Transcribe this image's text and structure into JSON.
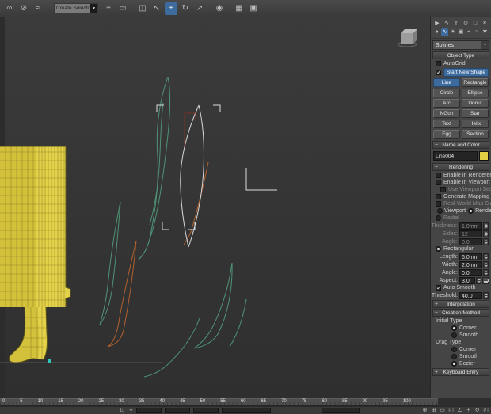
{
  "colors": {
    "accent_blue": "#3e6b9e",
    "object_yellow": "#d4c13b",
    "object_yellow_light": "#e3d249",
    "object_wire": "#81731f",
    "object_outline": "#5f5616",
    "spline_green": "#4f9377",
    "spline_white": "#d8d8d8",
    "spline_orange": "#b2602c",
    "spline_red": "#8a3020",
    "bracket_white": "#dddddd",
    "vertex_teal": "#2ec4b6",
    "ground_line": "#565656",
    "name_swatch": "#e0cf45"
  },
  "glyphs": {
    "dropdown_arrow": "▼"
  },
  "toolbar": {
    "selection_set_value": "Create Selection Se",
    "icons": [
      {
        "name": "select-and-link",
        "glyph": "∞"
      },
      {
        "name": "unlink-selection",
        "glyph": "⊘"
      },
      {
        "name": "bind-to-space-warp",
        "glyph": "≈"
      },
      {
        "name": "select-by-name",
        "glyph": "≡"
      },
      {
        "name": "rectangular-selection-region",
        "glyph": "▭"
      },
      {
        "name": "window-crossing",
        "glyph": "◫"
      },
      {
        "name": "select-object",
        "glyph": "↖"
      },
      {
        "name": "select-and-move",
        "glyph": "+"
      },
      {
        "name": "select-and-rotate",
        "glyph": "↻"
      },
      {
        "name": "select-and-scale",
        "glyph": "↗"
      },
      {
        "name": "material-editor",
        "glyph": "◉"
      },
      {
        "name": "render-setup",
        "glyph": "▦"
      },
      {
        "name": "rendered-frame-window",
        "glyph": "▣"
      }
    ]
  },
  "command_panel": {
    "tabs": [
      {
        "name": "create",
        "glyph": "▶"
      },
      {
        "name": "modify",
        "glyph": "∿"
      },
      {
        "name": "hierarchy",
        "glyph": "Y"
      },
      {
        "name": "motion",
        "glyph": "⊙"
      },
      {
        "name": "display",
        "glyph": "□"
      },
      {
        "name": "utilities",
        "glyph": "✶"
      }
    ],
    "categories": [
      {
        "name": "geometry",
        "glyph": "●"
      },
      {
        "name": "shapes",
        "glyph": "∿"
      },
      {
        "name": "lights",
        "glyph": "☀"
      },
      {
        "name": "cameras",
        "glyph": "▣"
      },
      {
        "name": "helpers",
        "glyph": "⌖"
      },
      {
        "name": "space-warps",
        "glyph": "≈"
      },
      {
        "name": "systems",
        "glyph": "✱"
      }
    ],
    "subcategory_dropdown": "Splines"
  },
  "object_type": {
    "header": "Object Type",
    "toggle": "−",
    "autogrid_label": "AutoGrid",
    "start_new_shape_label": "Start New Shape",
    "buttons": [
      {
        "label": "Line"
      },
      {
        "label": "Rectangle"
      },
      {
        "label": "Circle"
      },
      {
        "label": "Ellipse"
      },
      {
        "label": "Arc"
      },
      {
        "label": "Donut"
      },
      {
        "label": "NGon"
      },
      {
        "label": "Star"
      },
      {
        "label": "Text"
      },
      {
        "label": "Helix"
      },
      {
        "label": "Egg"
      },
      {
        "label": "Section"
      }
    ]
  },
  "name_and_color": {
    "header": "Name and Color",
    "toggle": "−",
    "object_name": "Line004"
  },
  "rendering": {
    "header": "Rendering",
    "toggle": "−",
    "enable_in_renderer": "Enable In Renderer",
    "enable_in_viewport": "Enable In Viewport",
    "use_viewport_settings": "Use Viewport Settings",
    "generate_mapping_coords": "Generate Mapping Coords.",
    "real_world_map_size": "Real-World Map Size",
    "viewport_radio": "Viewport",
    "renderer_radio": "Renderer",
    "radial_radio": "Radial",
    "thickness_label": "Thickness:",
    "thickness_value": "1.0mm",
    "sides_label": "Sides:",
    "sides_value": "12",
    "radial_angle_label": "Angle:",
    "radial_angle_value": "0.0",
    "rectangular_radio": "Rectangular",
    "length_label": "Length:",
    "length_value": "6.0mm",
    "width_label": "Width:",
    "width_value": "2.0mm",
    "rect_angle_label": "Angle:",
    "rect_angle_value": "0.0",
    "aspect_label": "Aspect:",
    "aspect_value": "3.0",
    "auto_smooth_label": "Auto Smooth",
    "threshold_label": "Threshold:",
    "threshold_value": "40.0"
  },
  "interpolation": {
    "header": "Interpolation",
    "toggle": "+"
  },
  "creation_method": {
    "header": "Creation Method",
    "toggle": "−",
    "initial_type_label": "Initial Type",
    "initial_corner": "Corner",
    "initial_smooth": "Smooth",
    "drag_type_label": "Drag Type",
    "drag_corner": "Corner",
    "drag_smooth": "Smooth",
    "drag_bezier": "Bezier"
  },
  "keyboard_entry": {
    "header": "Keyboard Entry",
    "toggle": "+"
  },
  "timeline": {
    "labels": [
      "0",
      "5",
      "10",
      "15",
      "20",
      "25",
      "30",
      "35",
      "40",
      "45",
      "50",
      "55",
      "60",
      "65",
      "70",
      "75",
      "80",
      "85",
      "90",
      "95",
      "100"
    ]
  },
  "status_icons": [
    {
      "name": "isolate-selection",
      "glyph": "⊡"
    },
    {
      "name": "selection-lock",
      "glyph": "⌖"
    }
  ],
  "nav_icons": [
    {
      "name": "zoom",
      "glyph": "⊕"
    },
    {
      "name": "zoom-all",
      "glyph": "⊞"
    },
    {
      "name": "zoom-extents",
      "glyph": "▭"
    },
    {
      "name": "zoom-extents-all",
      "glyph": "◱"
    },
    {
      "name": "field-of-view",
      "glyph": "∠"
    },
    {
      "name": "pan",
      "glyph": "+"
    },
    {
      "name": "orbit",
      "glyph": "↻"
    },
    {
      "name": "maximize-viewport",
      "glyph": "◰"
    }
  ]
}
